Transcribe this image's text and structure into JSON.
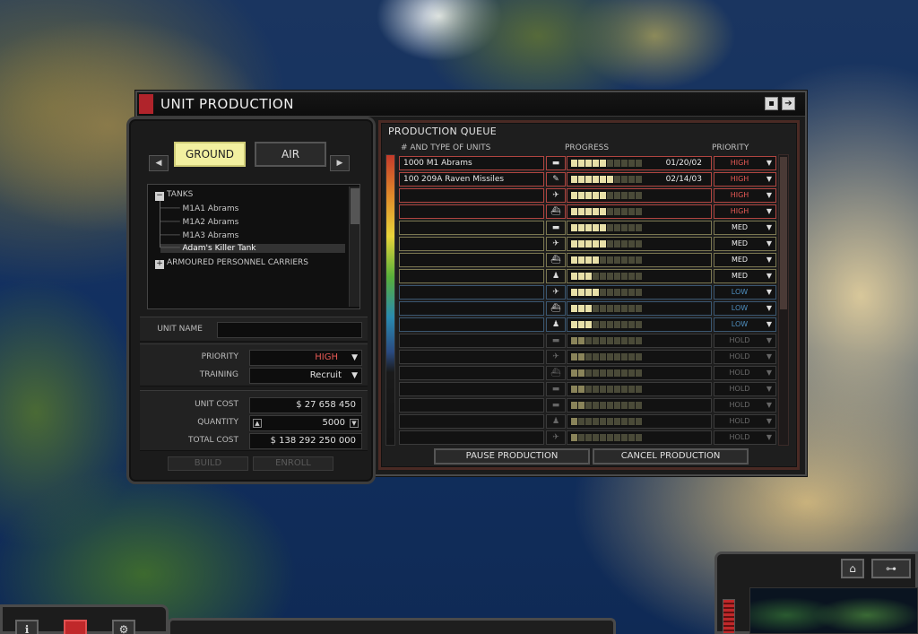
{
  "window": {
    "title": "UNIT PRODUCTION"
  },
  "left": {
    "tabs": [
      "GROUND",
      "AIR"
    ],
    "tree": {
      "groups": [
        {
          "label": "TANKS",
          "expanded": true,
          "items": [
            "M1A1 Abrams",
            "M1A2 Abrams",
            "M1A3 Abrams",
            "Adam's Killer Tank"
          ],
          "selected": "Adam's Killer Tank"
        },
        {
          "label": "ARMOURED PERSONNEL CARRIERS",
          "expanded": false
        }
      ]
    },
    "unit_name": {
      "label": "UNIT NAME",
      "value": ""
    },
    "priority": {
      "label": "PRIORITY",
      "value": "HIGH"
    },
    "training": {
      "label": "TRAINING",
      "value": "Recruit"
    },
    "unit_cost": {
      "label": "UNIT COST",
      "value": "$ 27 658 450"
    },
    "quantity": {
      "label": "QUANTITY",
      "value": "5000"
    },
    "total_cost": {
      "label": "TOTAL COST",
      "value": "$ 138 292 250 000"
    },
    "buttons": {
      "build": "BUILD",
      "enroll": "ENROLL"
    }
  },
  "queue": {
    "title": "PRODUCTION QUEUE",
    "columns": {
      "units": "# AND TYPE OF UNITS",
      "progress": "PROGRESS",
      "priority": "PRIORITY"
    },
    "segments_total": 10,
    "rows": [
      {
        "name": "1000 M1 Abrams",
        "icon": "tank-icon",
        "glyph": "▬",
        "progress": 0.5,
        "date": "01/20/02",
        "priority": "HIGH"
      },
      {
        "name": "100 209A Raven Missiles",
        "icon": "missile-icon",
        "glyph": "✎",
        "progress": 0.6,
        "date": "02/14/03",
        "priority": "HIGH"
      },
      {
        "name": "",
        "icon": "aircraft-icon",
        "glyph": "✈",
        "progress": 0.5,
        "date": "",
        "priority": "HIGH"
      },
      {
        "name": "",
        "icon": "ship-icon",
        "glyph": "⛴",
        "progress": 0.5,
        "date": "",
        "priority": "HIGH"
      },
      {
        "name": "",
        "icon": "tank-icon",
        "glyph": "▬",
        "progress": 0.5,
        "date": "",
        "priority": "MED"
      },
      {
        "name": "",
        "icon": "aircraft-icon",
        "glyph": "✈",
        "progress": 0.5,
        "date": "",
        "priority": "MED"
      },
      {
        "name": "",
        "icon": "ship-icon",
        "glyph": "⛴",
        "progress": 0.4,
        "date": "",
        "priority": "MED"
      },
      {
        "name": "",
        "icon": "infantry-icon",
        "glyph": "♟",
        "progress": 0.3,
        "date": "",
        "priority": "MED"
      },
      {
        "name": "",
        "icon": "aircraft-icon",
        "glyph": "✈",
        "progress": 0.4,
        "date": "",
        "priority": "LOW"
      },
      {
        "name": "",
        "icon": "ship-icon",
        "glyph": "⛴",
        "progress": 0.3,
        "date": "",
        "priority": "LOW"
      },
      {
        "name": "",
        "icon": "infantry-icon",
        "glyph": "♟",
        "progress": 0.3,
        "date": "",
        "priority": "LOW"
      },
      {
        "name": "",
        "icon": "tank-icon",
        "glyph": "▬",
        "progress": 0.2,
        "date": "",
        "priority": "HOLD"
      },
      {
        "name": "",
        "icon": "aircraft-icon",
        "glyph": "✈",
        "progress": 0.2,
        "date": "",
        "priority": "HOLD"
      },
      {
        "name": "",
        "icon": "ship-icon",
        "glyph": "⛴",
        "progress": 0.2,
        "date": "",
        "priority": "HOLD"
      },
      {
        "name": "",
        "icon": "tank-icon",
        "glyph": "▬",
        "progress": 0.2,
        "date": "",
        "priority": "HOLD"
      },
      {
        "name": "",
        "icon": "tank-icon",
        "glyph": "▬",
        "progress": 0.2,
        "date": "",
        "priority": "HOLD"
      },
      {
        "name": "",
        "icon": "infantry-icon",
        "glyph": "♟",
        "progress": 0.1,
        "date": "",
        "priority": "HOLD"
      },
      {
        "name": "",
        "icon": "aircraft-icon",
        "glyph": "✈",
        "progress": 0.1,
        "date": "",
        "priority": "HOLD"
      }
    ],
    "buttons": {
      "pause": "PAUSE PRODUCTION",
      "cancel": "CANCEL PRODUCTION"
    }
  },
  "colors": {
    "HIGH": "#e85a55",
    "MED": "#f0f0f0",
    "LOW": "#4f8fc0",
    "HOLD": "#6a6a6a",
    "border_HIGH": "#b04540",
    "border_MED": "#7a7650",
    "border_LOW": "#3a5670",
    "border_HOLD": "#3a3a3a",
    "tab_active": "#f2f0a0",
    "title_accent": "#b0242b"
  }
}
